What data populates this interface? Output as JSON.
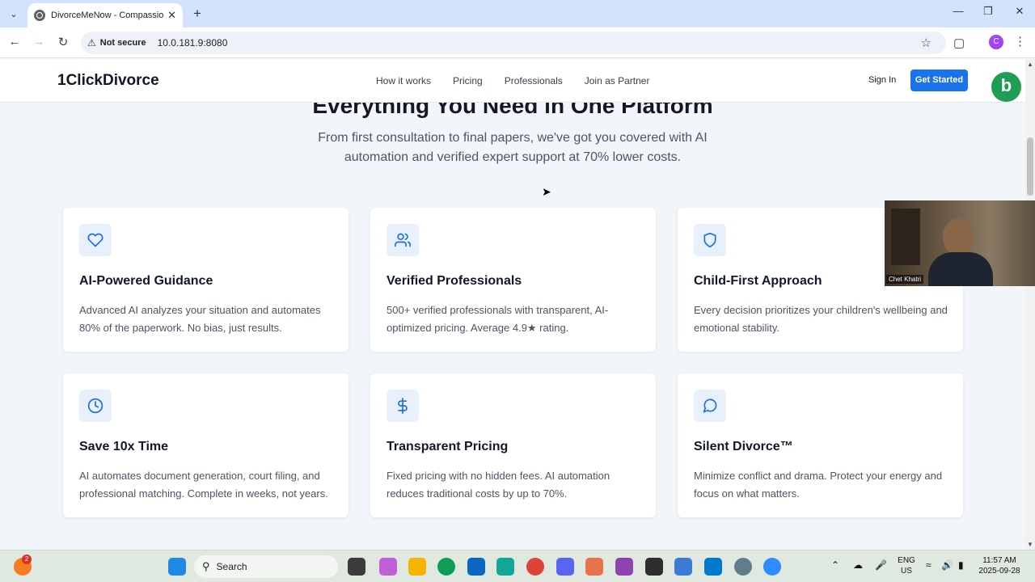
{
  "browser": {
    "tab_title": "DivorceMeNow - Compassiona",
    "new_tab_icon": "+",
    "security_label": "Not secure",
    "url": "10.0.181.9:8080",
    "profile_initial": "C"
  },
  "header": {
    "logo": "1ClickDivorce",
    "nav": [
      "How it works",
      "Pricing",
      "Professionals",
      "Join as Partner"
    ],
    "sign_in": "Sign In",
    "get_started": "Get Started"
  },
  "hero": {
    "title": "Everything You Need in One Platform",
    "subtitle": "From first consultation to final papers, we've got you covered with AI automation and verified expert support at 70% lower costs."
  },
  "features": [
    {
      "icon": "heart-icon",
      "title": "AI-Powered Guidance",
      "desc": "Advanced AI analyzes your situation and automates 80% of the paperwork. No bias, just results."
    },
    {
      "icon": "users-icon",
      "title": "Verified Professionals",
      "desc": "500+ verified professionals with transparent, AI-optimized pricing. Average 4.9★ rating."
    },
    {
      "icon": "shield-icon",
      "title": "Child-First Approach",
      "desc": "Every decision prioritizes your children's wellbeing and emotional stability."
    },
    {
      "icon": "clock-icon",
      "title": "Save 10x Time",
      "desc": "AI automates document generation, court filing, and professional matching. Complete in weeks, not years."
    },
    {
      "icon": "dollar-icon",
      "title": "Transparent Pricing",
      "desc": "Fixed pricing with no hidden fees. AI automation reduces traditional costs by up to 70%."
    },
    {
      "icon": "chat-icon",
      "title": "Silent Divorce™",
      "desc": "Minimize conflict and drama. Protect your energy and focus on what matters."
    }
  ],
  "video": {
    "participant": "Chet Khatri"
  },
  "taskbar": {
    "search_label": "Search",
    "notification_count": "2",
    "lang_line1": "ENG",
    "lang_line2": "US",
    "time": "11:57 AM",
    "date": "2025-09-28"
  },
  "colors": {
    "accent": "#1a73e8",
    "icon_blue": "#1e6fd9",
    "icon_bg": "#e8f1fb"
  }
}
